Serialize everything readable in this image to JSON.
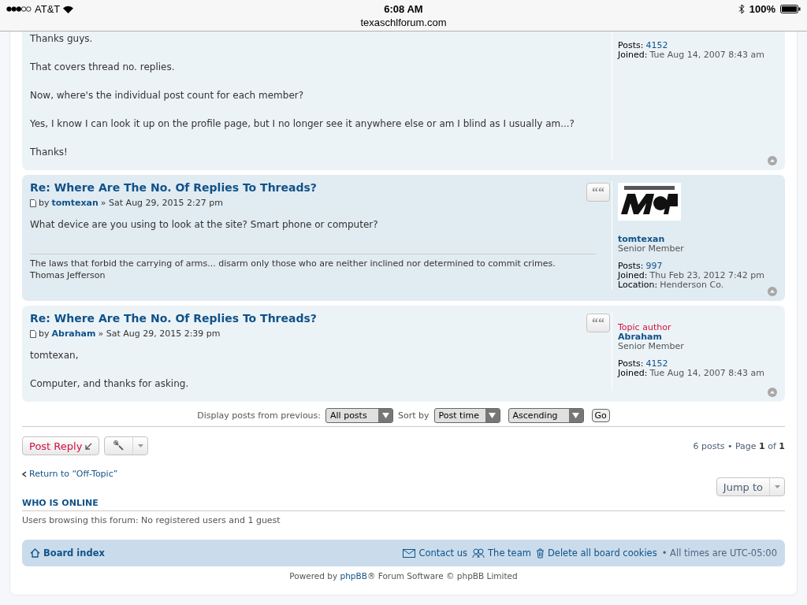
{
  "status_bar": {
    "carrier": "AT&T",
    "time": "6:08 AM",
    "url": "texaschlforum.com",
    "battery": "100%"
  },
  "posts": [
    {
      "partial": true,
      "body": [
        "Thanks guys.",
        "That covers thread no. replies.",
        "Now, where's the individual post count for each member?",
        "Yes, I know I can look it up on the profile page, but I no longer see it anywhere else or am I blind as I usually am...?",
        "Thanks!"
      ],
      "profile": {
        "posts_label": "Posts:",
        "posts": "4152",
        "joined_label": "Joined:",
        "joined": "Tue Aug 14, 2007 8:43 am"
      }
    },
    {
      "partial": false,
      "title": "Re: Where Are The No. Of Replies To Threads?",
      "by": "by",
      "author": "tomtexan",
      "date": "» Sat Aug 29, 2015 2:27 pm",
      "quote": "“",
      "body": [
        "What device are you using to look at the site? Smart phone or computer?"
      ],
      "signature": [
        "The laws that forbid the carrying of arms... disarm only those who are neither inclined nor determined to commit crimes.",
        "Thomas Jefferson"
      ],
      "profile": {
        "avatar": true,
        "username": "tomtexan",
        "rank": "Senior Member",
        "posts_label": "Posts:",
        "posts": "997",
        "joined_label": "Joined:",
        "joined": "Thu Feb 23, 2012 7:42 pm",
        "location_label": "Location:",
        "location": "Henderson Co."
      }
    },
    {
      "partial": false,
      "title": "Re: Where Are The No. Of Replies To Threads?",
      "by": "by",
      "author": "Abraham",
      "date": "» Sat Aug 29, 2015 2:39 pm",
      "quote": "“",
      "body": [
        "tomtexan,",
        "Computer, and thanks for asking."
      ],
      "profile": {
        "badge": "Topic author",
        "username": "Abraham",
        "rank": "Senior Member",
        "posts_label": "Posts:",
        "posts": "4152",
        "joined_label": "Joined:",
        "joined": "Tue Aug 14, 2007 8:43 am"
      }
    }
  ],
  "sort_bar": {
    "display_label": "Display posts from previous:",
    "display_value": "All posts",
    "sort_label": "Sort by",
    "sort_value": "Post time",
    "order_value": "Ascending",
    "go": "Go"
  },
  "actions": {
    "post_reply": "Post Reply",
    "pagination": "6 posts • Page **1** of **1**"
  },
  "return_link": "Return to “Off-Topic”",
  "jump_to": "Jump to",
  "who_is_online": {
    "heading": "WHO IS ONLINE",
    "text": "Users browsing this forum: No registered users and 1 guest"
  },
  "footer_nav": {
    "board_index": "Board index",
    "links": [
      {
        "kind": "mail",
        "label": "Contact us"
      },
      {
        "kind": "team",
        "label": "The team"
      },
      {
        "kind": "trash",
        "label": "Delete all board cookies"
      }
    ],
    "timezone": "• All times are UTC-05:00"
  },
  "credit": {
    "before": "Powered by",
    "link": "phpBB",
    "after": "® Forum Software © phpBB Limited"
  }
}
